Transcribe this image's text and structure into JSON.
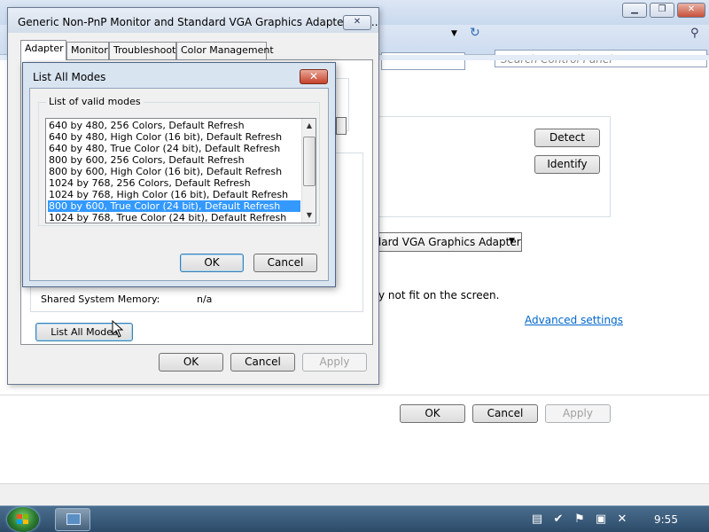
{
  "background_window": {
    "search_placeholder": "Search Control Panel",
    "detect_button": "Detect",
    "identify_button": "Identify",
    "display_select_value": "ndard VGA Graphics Adapter",
    "fit_text": "y not fit on the screen.",
    "advanced_settings_link": "Advanced settings",
    "ok_button": "OK",
    "cancel_button": "Cancel",
    "apply_button": "Apply"
  },
  "adapter_dialog": {
    "title": "Generic Non-PnP Monitor and Standard VGA Graphics Adapter Pro...",
    "tabs": [
      {
        "label": "Adapter",
        "active": true
      },
      {
        "label": "Monitor",
        "active": false
      },
      {
        "label": "Troubleshoot",
        "active": false
      },
      {
        "label": "Color Management",
        "active": false
      }
    ],
    "shared_memory_label": "Shared System Memory:",
    "shared_memory_value": "n/a",
    "list_all_modes_button": "List All Modes",
    "ok_button": "OK",
    "cancel_button": "Cancel",
    "apply_button": "Apply"
  },
  "modes_dialog": {
    "title": "List All Modes",
    "group_label": "List of valid modes",
    "modes": [
      {
        "label": "640 by 480, 256 Colors, Default Refresh",
        "selected": false
      },
      {
        "label": "640 by 480, High Color (16 bit), Default Refresh",
        "selected": false
      },
      {
        "label": "640 by 480, True Color (24 bit), Default Refresh",
        "selected": false
      },
      {
        "label": "800 by 600, 256 Colors, Default Refresh",
        "selected": false
      },
      {
        "label": "800 by 600, High Color (16 bit), Default Refresh",
        "selected": false
      },
      {
        "label": "1024 by 768, 256 Colors, Default Refresh",
        "selected": false
      },
      {
        "label": "1024 by 768, High Color (16 bit), Default Refresh",
        "selected": false
      },
      {
        "label": "800 by 600, True Color (24 bit), Default Refresh",
        "selected": true
      },
      {
        "label": "1024 by 768, True Color (24 bit), Default Refresh",
        "selected": false
      }
    ],
    "ok_button": "OK",
    "cancel_button": "Cancel"
  },
  "taskbar": {
    "clock": "9:55"
  },
  "colors": {
    "selection": "#3399ff",
    "taskbar": "#2c4b69",
    "link": "#0066cc"
  }
}
